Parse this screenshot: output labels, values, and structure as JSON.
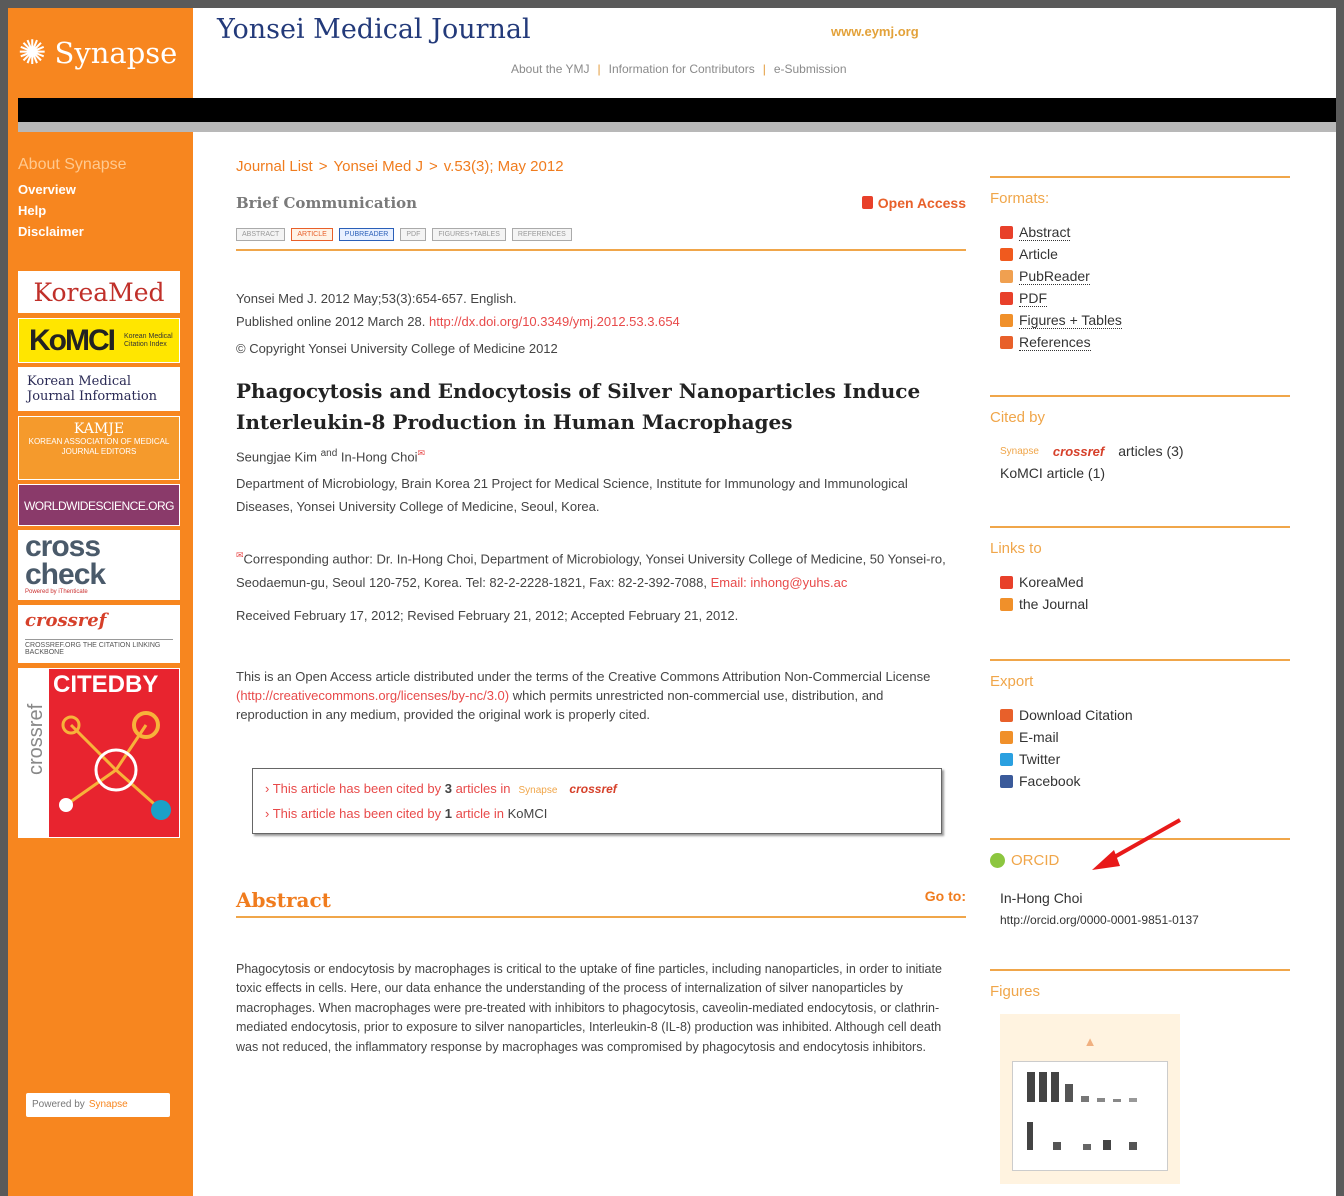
{
  "synapse": {
    "logo_text": "Synapse",
    "powered_by": "Powered by",
    "powered_brand": "Synapse"
  },
  "leftnav": {
    "heading": "About Synapse",
    "items": [
      "Overview",
      "Help",
      "Disclaimer"
    ]
  },
  "banners": {
    "koreamed": "KoreaMed",
    "komci": "KoMCI",
    "komci_small": "Korean Medical Citation Index",
    "kmji": "Korean Medical Journal Information",
    "kamje": "KAMJE",
    "kamje_sub": "KOREAN ASSOCIATION OF MEDICAL JOURNAL EDITORS",
    "wws": "WORLDWIDESCIENCE.ORG",
    "crosscheck": "cross check",
    "crosscheck_sub": "Powered by iThenticate",
    "crossref": "crossref",
    "crossref_sub": "CROSSREF.ORG THE CITATION LINKING BACKBONE",
    "citedby": "CITEDBY",
    "citedby_side": "crossref"
  },
  "header": {
    "title": "Yonsei Medical Journal",
    "url": "www.eymj.org",
    "nav": [
      "About the YMJ",
      "Information for Contributors",
      "e-Submission"
    ]
  },
  "breadcrumb": [
    "Journal List",
    "Yonsei Med J",
    "v.53(3); May 2012"
  ],
  "article": {
    "type": "Brief Communication",
    "open_access": "Open Access",
    "format_buttons": [
      "ABSTRACT",
      "ARTICLE",
      "PUBREADER",
      "PDF",
      "FIGURES+TABLES",
      "REFERENCES"
    ],
    "citation": "Yonsei Med J. 2012 May;53(3):654-657. English.",
    "published": "Published online 2012 March 28.",
    "doi": "http://dx.doi.org/10.3349/ymj.2012.53.3.654",
    "copyright": "© Copyright Yonsei University College of Medicine 2012",
    "title": "Phagocytosis and Endocytosis of Silver Nanoparticles Induce Interleukin-8 Production in Human Macrophages",
    "author1": "Seungjae Kim",
    "author_and": "and",
    "author2": "In-Hong Choi",
    "affiliation": "Department of Microbiology, Brain Korea 21 Project for Medical Science, Institute for Immunology and Immunological Diseases, Yonsei University College of Medicine, Seoul, Korea.",
    "corresponding": "Corresponding author: Dr. In-Hong Choi, Department of Microbiology, Yonsei University College of Medicine, 50 Yonsei-ro, Seodaemun-gu, Seoul 120-752, Korea. Tel: 82-2-2228-1821, Fax: 82-2-392-7088,",
    "email_label": "Email:",
    "email": "inhong@yuhs.ac",
    "dates": "Received February 17, 2012; Revised February 21, 2012; Accepted February 21, 2012.",
    "license_pre": "This is an Open Access article distributed under the terms of the Creative Commons Attribution Non-Commercial License",
    "license_link": "(http://creativecommons.org/licenses/by-nc/3.0)",
    "license_post": "which permits unrestricted non-commercial use, distribution, and reproduction in any medium, provided the original work is properly cited.",
    "cited1_pre": "This article has been cited by",
    "cited1_num": "3",
    "cited1_post": "articles in",
    "cited1_syn": "Synapse",
    "cited1_cref": "crossref",
    "cited2_pre": "This article has been cited by",
    "cited2_num": "1",
    "cited2_post": "article in",
    "cited2_src": "KoMCI",
    "abstract_title": "Abstract",
    "goto": "Go to:",
    "abstract": "Phagocytosis or endocytosis by macrophages is critical to the uptake of fine particles, including nanoparticles, in order to initiate toxic effects in cells. Here, our data enhance the understanding of the process of internalization of silver nanoparticles by macrophages. When macrophages were pre-treated with inhibitors to phagocytosis, caveolin-mediated endocytosis, or clathrin-mediated endocytosis, prior to exposure to silver nanoparticles, Interleukin-8 (IL-8) production was inhibited. Although cell death was not reduced, the inflammatory response by macrophages was compromised by phagocytosis and endocytosis inhibitors."
  },
  "sidebar": {
    "formats_head": "Formats:",
    "formats": [
      "Abstract",
      "Article",
      "PubReader",
      "PDF",
      "Figures + Tables",
      "References"
    ],
    "citedby_head": "Cited by",
    "citedby_syn": "Synapse",
    "citedby_cref": "crossref",
    "citedby_count": "articles (3)",
    "citedby_komci": "KoMCI article (1)",
    "links_head": "Links to",
    "links": [
      "KoreaMed",
      "the Journal"
    ],
    "export_head": "Export",
    "export": [
      "Download Citation",
      "E-mail",
      "Twitter",
      "Facebook"
    ],
    "orcid_head": "ORCID",
    "orcid_name": "In-Hong Choi",
    "orcid_url": "http://orcid.org/0000-0001-9851-0137",
    "figures_head": "Figures"
  },
  "colors": {
    "orange": "#f7861f",
    "accent": "#f07c1e",
    "title_blue": "#233a7a",
    "link_red": "#e84a4a"
  }
}
